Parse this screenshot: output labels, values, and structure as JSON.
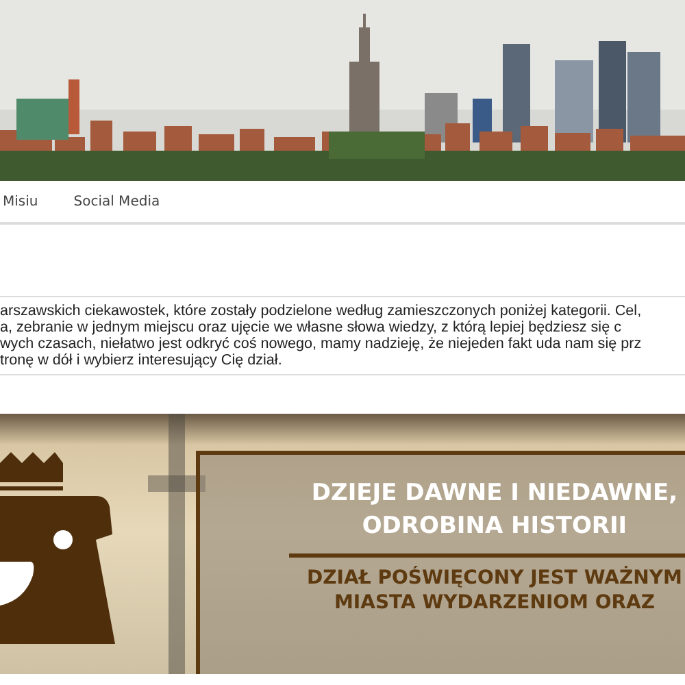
{
  "nav": {
    "items": [
      {
        "label": "Misiu",
        "selected": false
      },
      {
        "label": "Social Media",
        "selected": false
      }
    ]
  },
  "intro": {
    "lines": [
      "arszawskich ciekawostek, które zostały podzielone według zamieszczonych poniżej kategorii. Cel,",
      "a, zebranie w jednym miejscu oraz ujęcie we własne słowa wiedzy, z którą lepiej będziesz się c",
      "wych czasach, niełatwo jest odkryć coś nowego, mamy nadzieję, że niejeden fakt uda nam się prz",
      "tronę w dół i wybierz interesujący Cię dział."
    ]
  },
  "section": {
    "title_lines": [
      "DZIEJE DAWNE I NIEDAWNE,",
      "ODROBINA HISTORII"
    ],
    "subtitle_lines": [
      "DZIAŁ POŚWIĘCONY JEST WAŻNYM",
      "MIASTA WYDARZENIOM ORAZ"
    ]
  }
}
